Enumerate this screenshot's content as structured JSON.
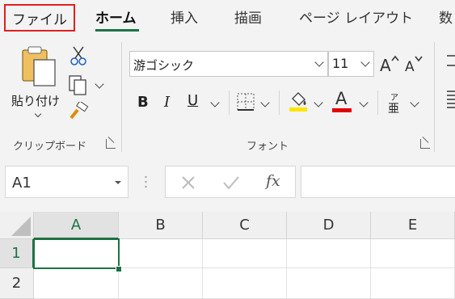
{
  "tabs": [
    "ファイル",
    "ホーム",
    "挿入",
    "描画",
    "ページ レイアウト",
    "数"
  ],
  "clipboard": {
    "paste_label": "貼り付け",
    "group_label": "クリップボード"
  },
  "font": {
    "name": "游ゴシック",
    "size": "11",
    "bold": "B",
    "italic": "I",
    "underline": "U",
    "font_color_letter": "A",
    "phonetic_top": "ア",
    "phonetic_bottom": "亜",
    "group_label": "フォント"
  },
  "formula_bar": {
    "name_box": "A1",
    "fx": "fx",
    "formula": ""
  },
  "grid": {
    "columns": [
      "A",
      "B",
      "C",
      "D",
      "E"
    ],
    "rows": [
      "1",
      "2"
    ],
    "active_cell": "A1"
  },
  "colors": {
    "accent_green": "#1e7145",
    "file_highlight": "#e02020",
    "font_color_red": "#e00000",
    "highlight_yellow": "#ffe600"
  }
}
